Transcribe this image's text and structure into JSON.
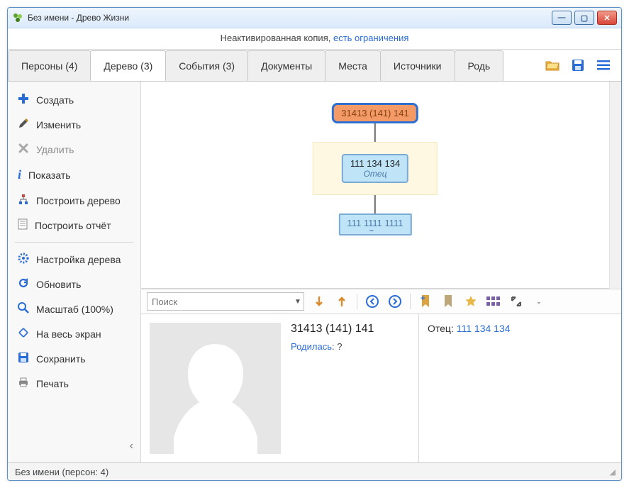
{
  "window": {
    "title": "Без имени - Древо Жизни"
  },
  "strip": {
    "text": "Неактивированная копия, ",
    "link": "есть ограничения"
  },
  "tabs": [
    {
      "label": "Персоны (4)"
    },
    {
      "label": "Дерево (3)"
    },
    {
      "label": "События (3)"
    },
    {
      "label": "Документы"
    },
    {
      "label": "Места"
    },
    {
      "label": "Источники"
    },
    {
      "label": "Родь"
    }
  ],
  "sidebar": {
    "create": "Создать",
    "edit": "Изменить",
    "delete": "Удалить",
    "show": "Показать",
    "build_tree": "Построить дерево",
    "build_report": "Построить отчёт",
    "tree_settings": "Настройка дерева",
    "refresh": "Обновить",
    "zoom": "Масштаб (100%)",
    "fullscreen": "На весь экран",
    "save": "Сохранить",
    "print": "Печать"
  },
  "tree": {
    "root": "31413 (141) 141",
    "mid_name": "111 134 134",
    "mid_sub": "Отец",
    "child_name": "111 1111 1111",
    "child_sub": "Лол"
  },
  "search": {
    "placeholder": "Поиск"
  },
  "person": {
    "name": "31413 (141) 141",
    "born_label": "Родилась",
    "born_value": ": ?"
  },
  "relation": {
    "label": "Отец: ",
    "link": "111 134 134"
  },
  "status": {
    "text": "Без имени (персон: 4)"
  },
  "colors": {
    "accent": "#2a6cd6"
  }
}
